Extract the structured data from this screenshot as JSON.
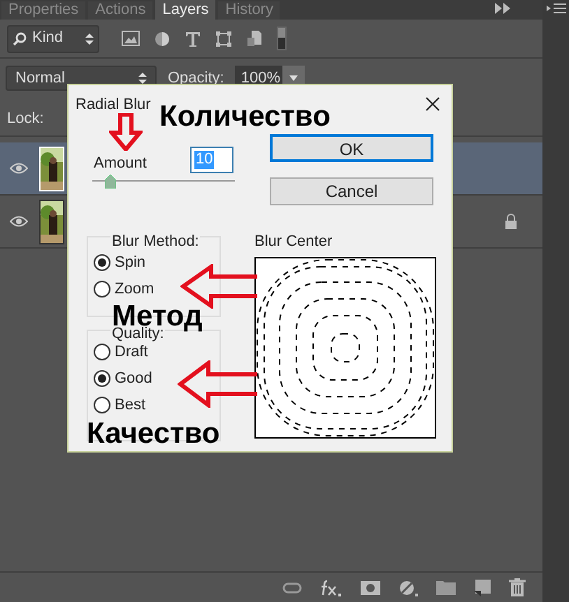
{
  "panel_tabs": [
    {
      "label": "Properties",
      "selected": false
    },
    {
      "label": "Actions",
      "selected": false
    },
    {
      "label": "Layers",
      "selected": true
    },
    {
      "label": "History",
      "selected": false
    }
  ],
  "filter": {
    "value": "Kind"
  },
  "blend_mode": {
    "value": "Normal"
  },
  "opacity": {
    "label": "Opacity:",
    "value": "100%"
  },
  "lock": {
    "label": "Lock:"
  },
  "layers": [
    {
      "visible": true,
      "selected": true,
      "locked": false
    },
    {
      "visible": true,
      "selected": false,
      "locked": true
    }
  ],
  "dialog": {
    "title": "Radial Blur",
    "amount": {
      "label": "Amount",
      "value": "10",
      "level": 0.1
    },
    "buttons": [
      "OK",
      "Cancel"
    ],
    "blur_method": {
      "label": "Blur Method:",
      "options": [
        {
          "label": "Spin",
          "selected": true
        },
        {
          "label": "Zoom",
          "selected": false
        }
      ]
    },
    "quality": {
      "label": "Quality:",
      "options": [
        {
          "label": "Draft",
          "selected": false
        },
        {
          "label": "Good",
          "selected": true
        },
        {
          "label": "Best",
          "selected": false
        }
      ]
    },
    "blur_center": {
      "label": "Blur Center"
    }
  },
  "annotations": [
    "Количество",
    "Метод",
    "Качество"
  ]
}
